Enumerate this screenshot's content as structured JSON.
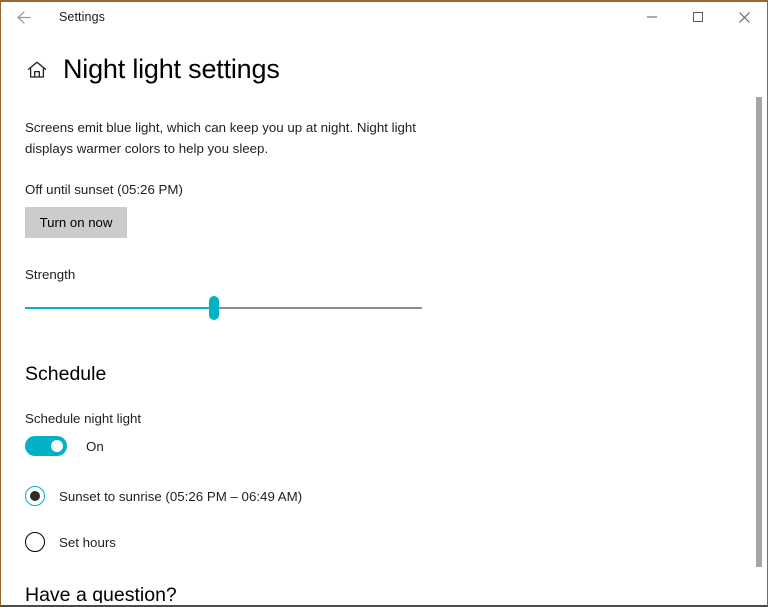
{
  "window": {
    "title": "Settings",
    "accent_color": "#96682f",
    "controls": {
      "back": "back-arrow",
      "minimize": "Minimize",
      "maximize": "Maximize",
      "close": "Close"
    }
  },
  "page": {
    "title": "Night light settings",
    "home_icon": "home-icon",
    "description": "Screens emit blue light, which can keep you up at night. Night light displays warmer colors to help you sleep.",
    "status": "Off until sunset (05:26 PM)",
    "turn_on_button": "Turn on now"
  },
  "strength": {
    "label": "Strength",
    "value": 48,
    "min": 0,
    "max": 100,
    "accent_color": "#00b2c3"
  },
  "schedule": {
    "heading": "Schedule",
    "toggle_label": "Schedule night light",
    "toggle_state": "On",
    "toggle_on": true,
    "options": [
      {
        "label": "Sunset to sunrise (05:26 PM – 06:49 AM)",
        "selected": true
      },
      {
        "label": "Set hours",
        "selected": false
      }
    ]
  },
  "footer": {
    "heading": "Have a question?"
  }
}
